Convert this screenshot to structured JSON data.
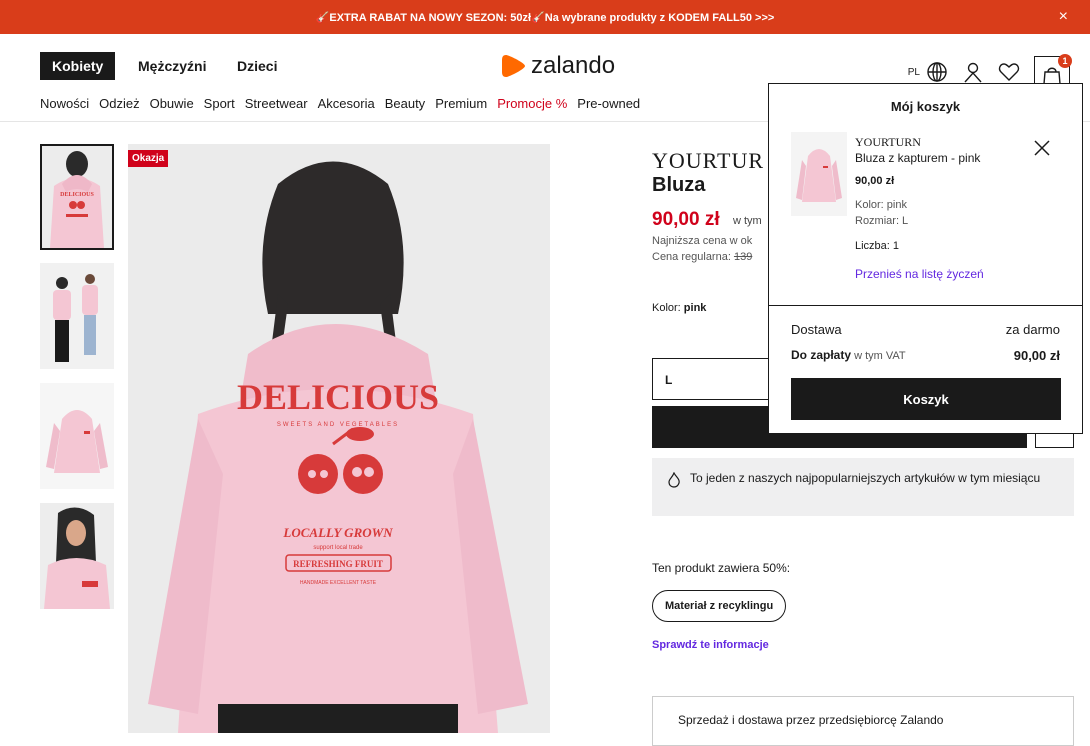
{
  "promo": {
    "text": "🎸EXTRA RABAT NA NOWY SEZON: 50zł🎸Na wybrane produkty z KODEM FALL50 >>>",
    "close": "×"
  },
  "nav": {
    "genders": [
      "Kobiety",
      "Mężczyźni",
      "Dzieci"
    ],
    "logo": "zalando",
    "lang": "PL",
    "cart_count": "1",
    "categories": [
      "Nowości",
      "Odzież",
      "Obuwie",
      "Sport",
      "Streetwear",
      "Akcesoria",
      "Beauty",
      "Premium",
      "Promocje %",
      "Pre-owned"
    ]
  },
  "product": {
    "badge": "Okazja",
    "brand": "YOURTUR",
    "title": "Bluza",
    "price": "90,00 zł",
    "vat": "w tym",
    "lowest": "Najniższa cena w ok",
    "regular_label": "Cena regularna: ",
    "regular_price": "139",
    "color_label": "Kolor: ",
    "color_value": "pink",
    "size": "L",
    "popular": "To jeden z naszych najpopularniejszych artykułów w tym miesiącu",
    "contains": "Ten produkt zawiera 50%:",
    "recycle": "Materiał z recyklingu",
    "check": "Sprawdź te informacje",
    "seller": "Sprzedaż i dostawa przez przedsiębiorcę Zalando",
    "print": {
      "headline": "DELICIOUS",
      "arc": "SWEETS AND VEGETABLES",
      "grown": "LOCALLY GROWN",
      "support": "support local trade",
      "fruit": "REFRESHING FRUIT",
      "small": "HANDMADE EXCELLENT TASTE"
    }
  },
  "cart": {
    "title": "Mój koszyk",
    "brand": "YOURTURN",
    "name": "Bluza z kapturem - pink",
    "price": "90,00 zł",
    "color": "Kolor: pink",
    "size": "Rozmiar: L",
    "qty": "Liczba: 1",
    "move": "Przenieś na listę życzeń",
    "shipping_label": "Dostawa",
    "shipping_value": "za darmo",
    "pay_label": "Do zapłaty",
    "pay_vat": " w tym VAT",
    "pay_value": "90,00 zł",
    "button": "Koszyk"
  },
  "colors": {
    "accent": "#d93d1a",
    "sale": "#d0021b",
    "link": "#6328e0",
    "hoodie": "#f4c6d3"
  }
}
